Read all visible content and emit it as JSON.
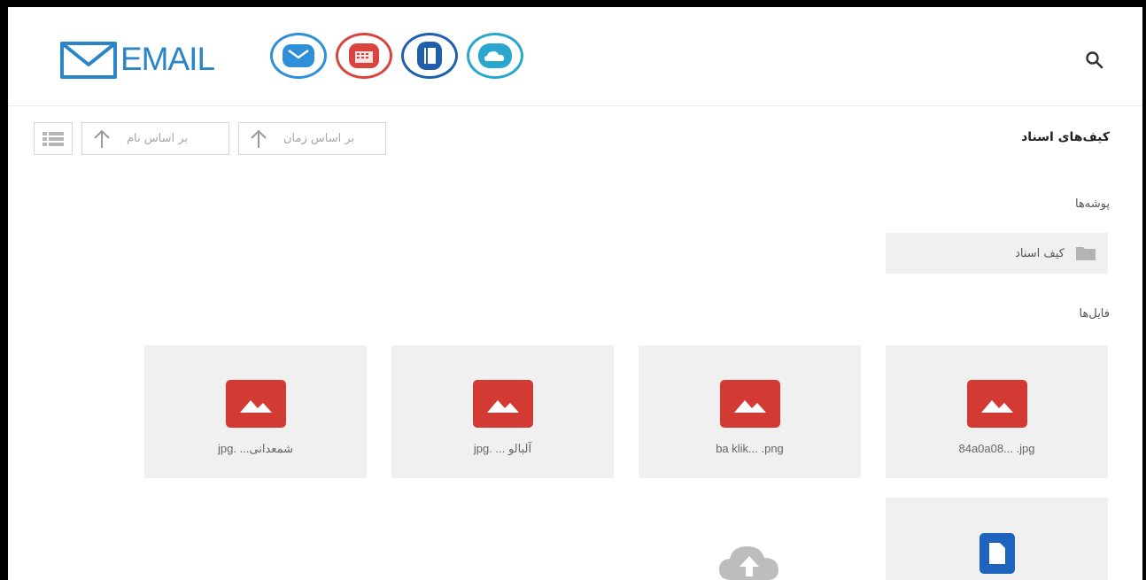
{
  "header": {
    "logo_text": "EMAIL",
    "apps": [
      {
        "name": "mail",
        "color": "#2f8fd8"
      },
      {
        "name": "calendar",
        "color": "#d9453e"
      },
      {
        "name": "docs",
        "color": "#1f5fae"
      },
      {
        "name": "cloud",
        "color": "#2aa7cc"
      }
    ]
  },
  "toolbar": {
    "sort_by_time_label": "بر اساس زمان",
    "sort_by_name_label": "بر اساس نام"
  },
  "page": {
    "title": "کیف‌های اسناد"
  },
  "folders": {
    "section_title": "پوشه‌ها",
    "items": [
      {
        "label": "کیف اسناد"
      }
    ]
  },
  "files": {
    "section_title": "فایل‌ها",
    "items": [
      {
        "name": "84a0a08... .jpg",
        "type": "image"
      },
      {
        "name": "ba klik... .png",
        "type": "image"
      },
      {
        "name": "jpg. ... آلبالو",
        "type": "image"
      },
      {
        "name": "jpg. ...شمعدانی",
        "type": "image"
      },
      {
        "name": "",
        "type": "document"
      }
    ]
  },
  "colors": {
    "brand": "#2b86c7",
    "image_icon": "#d23a33",
    "doc_icon": "#1e63bd",
    "card_bg": "#f0f0f0"
  }
}
